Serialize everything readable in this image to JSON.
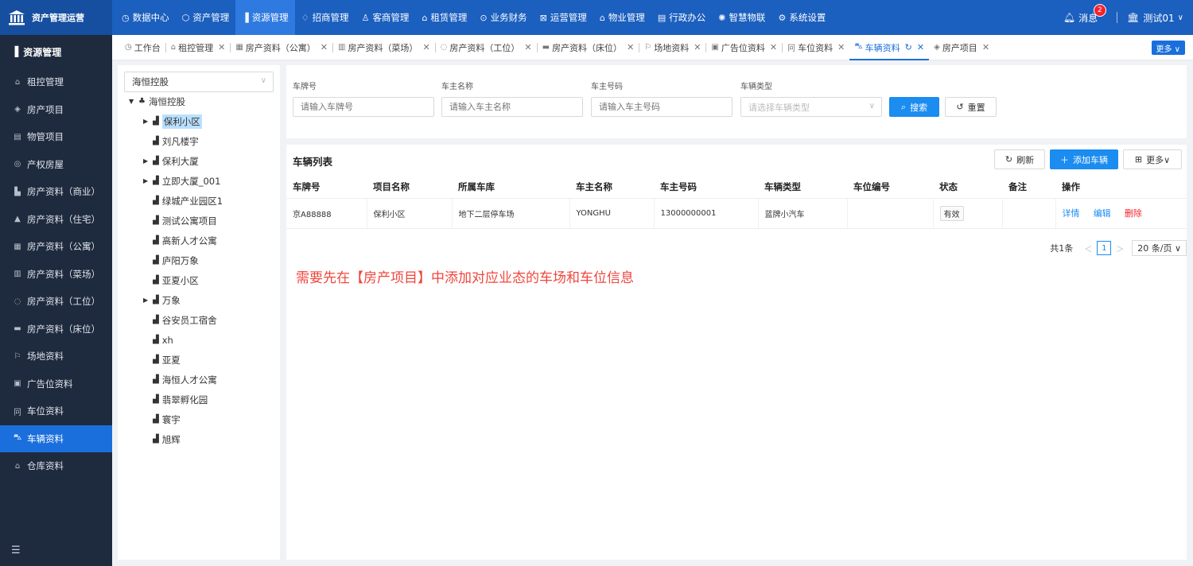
{
  "app": {
    "title": "资产管理运营"
  },
  "topnav": [
    {
      "icon": "◷",
      "label": "数据中心"
    },
    {
      "icon": "⬡",
      "label": "资产管理"
    },
    {
      "icon": "▐",
      "label": "资源管理"
    },
    {
      "icon": "♢",
      "label": "招商管理"
    },
    {
      "icon": "♙",
      "label": "客商管理"
    },
    {
      "icon": "⌂",
      "label": "租赁管理"
    },
    {
      "icon": "⊙",
      "label": "业务财务"
    },
    {
      "icon": "⊠",
      "label": "运营管理"
    },
    {
      "icon": "⌂",
      "label": "物业管理"
    },
    {
      "icon": "▤",
      "label": "行政办公"
    },
    {
      "icon": "✺",
      "label": "智慧物联"
    },
    {
      "icon": "⚙",
      "label": "系统设置"
    }
  ],
  "header_right": {
    "messages_label": "消息",
    "messages_count": "2",
    "user_label": "测试01"
  },
  "sidebar": {
    "title": "资源管理",
    "items": [
      {
        "icon": "⌂",
        "label": "租控管理"
      },
      {
        "icon": "◈",
        "label": "房产项目"
      },
      {
        "icon": "▤",
        "label": "物管项目"
      },
      {
        "icon": "◎",
        "label": "产权房屋"
      },
      {
        "icon": "▙",
        "label": "房产资料（商业）"
      },
      {
        "icon": "▲",
        "label": "房产资料（住宅）"
      },
      {
        "icon": "▦",
        "label": "房产资料（公寓）"
      },
      {
        "icon": "▥",
        "label": "房产资料（菜场）"
      },
      {
        "icon": "◌",
        "label": "房产资料（工位）"
      },
      {
        "icon": "▬",
        "label": "房产资料（床位）"
      },
      {
        "icon": "⚐",
        "label": "场地资料"
      },
      {
        "icon": "▣",
        "label": "广告位资料"
      },
      {
        "icon": "冋",
        "label": "车位资料"
      },
      {
        "icon": "⛍",
        "label": "车辆资料"
      },
      {
        "icon": "⌂",
        "label": "仓库资料"
      }
    ]
  },
  "tabs": [
    {
      "icon": "◷",
      "label": "工作台",
      "closable": false
    },
    {
      "icon": "⌂",
      "label": "租控管理",
      "closable": true
    },
    {
      "icon": "▦",
      "label": "房产资料（公寓）",
      "closable": true
    },
    {
      "icon": "▥",
      "label": "房产资料（菜场）",
      "closable": true
    },
    {
      "icon": "◌",
      "label": "房产资料（工位）",
      "closable": true
    },
    {
      "icon": "▬",
      "label": "房产资料（床位）",
      "closable": true
    },
    {
      "icon": "⚐",
      "label": "场地资料",
      "closable": true
    },
    {
      "icon": "▣",
      "label": "广告位资料",
      "closable": true
    },
    {
      "icon": "冋",
      "label": "车位资料",
      "closable": true
    },
    {
      "icon": "⛍",
      "label": "车辆资料",
      "closable": true
    },
    {
      "icon": "◈",
      "label": "房产项目",
      "closable": true
    }
  ],
  "tabs_more_label": "更多 ∨",
  "tree": {
    "select_value": "海恒控股",
    "root": "海恒控股",
    "nodes": [
      {
        "label": "保利小区",
        "expandable": true
      },
      {
        "label": "刘凡楼宇",
        "expandable": false
      },
      {
        "label": "保利大厦",
        "expandable": true
      },
      {
        "label": "立即大厦_001",
        "expandable": true
      },
      {
        "label": "绿城产业园区1",
        "expandable": false
      },
      {
        "label": "测试公寓项目",
        "expandable": false
      },
      {
        "label": "高新人才公寓",
        "expandable": false
      },
      {
        "label": "庐阳万象",
        "expandable": false
      },
      {
        "label": "亚夏小区",
        "expandable": false
      },
      {
        "label": "万象",
        "expandable": true
      },
      {
        "label": "谷安员工宿舍",
        "expandable": false
      },
      {
        "label": "xh",
        "expandable": false
      },
      {
        "label": "亚夏",
        "expandable": false
      },
      {
        "label": "海恒人才公寓",
        "expandable": false
      },
      {
        "label": "翡翠孵化园",
        "expandable": false
      },
      {
        "label": "寰宇",
        "expandable": false
      },
      {
        "label": "旭辉",
        "expandable": false
      }
    ]
  },
  "search": {
    "plate_label": "车牌号",
    "plate_placeholder": "请输入车牌号",
    "owner_label": "车主名称",
    "owner_placeholder": "请输入车主名称",
    "phone_label": "车主号码",
    "phone_placeholder": "请输入车主号码",
    "type_label": "车辆类型",
    "type_placeholder": "请选择车辆类型",
    "search_btn": "搜索",
    "reset_btn": "重置"
  },
  "table": {
    "title": "车辆列表",
    "refresh_btn": "刷新",
    "add_btn": "添加车辆",
    "more_btn": "更多∨",
    "columns": [
      "车牌号",
      "项目名称",
      "所属车库",
      "车主名称",
      "车主号码",
      "车辆类型",
      "车位编号",
      "状态",
      "备注",
      "操作"
    ],
    "rows": [
      {
        "plate": "京A88888",
        "project": "保利小区",
        "garage": "地下二层停车场",
        "owner": "YONGHU",
        "phone": "13000000001",
        "type": "蓝牌小汽车",
        "space": "",
        "status": "有效",
        "remark": ""
      }
    ],
    "actions": {
      "detail": "详情",
      "edit": "编辑",
      "delete": "删除"
    }
  },
  "pager": {
    "total": "共1条",
    "current": "1",
    "size": "20 条/页 ∨"
  },
  "notice": "需要先在【房产项目】中添加对应业态的车场和车位信息"
}
